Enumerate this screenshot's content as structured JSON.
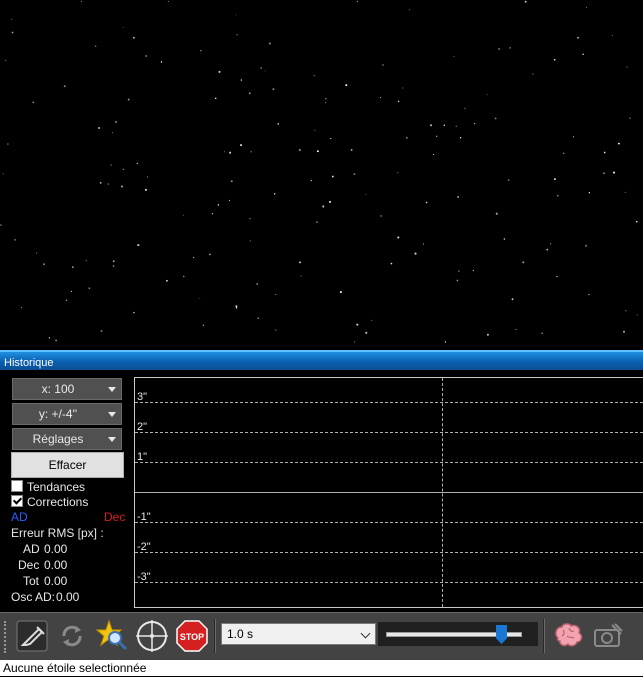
{
  "panel": {
    "title": "Historique"
  },
  "controls": {
    "x_scale": "x: 100",
    "y_scale": "y: +/-4''",
    "settings": "Réglages",
    "clear": "Effacer",
    "trends": {
      "label": "Tendances",
      "checked": false
    },
    "corrections": {
      "label": "Corrections",
      "checked": true
    },
    "legend_ra": "AD",
    "legend_dec": "Dec"
  },
  "stats": {
    "rms_title": "Erreur RMS [px] :",
    "ad_label": "AD",
    "ad_value": "0.00",
    "dec_label": "Dec",
    "dec_value": "0.00",
    "tot_label": "Tot",
    "tot_value": "0.00",
    "osc_label": "Osc AD:",
    "osc_value": "0.00"
  },
  "graph": {
    "y_labels": [
      "3\"",
      "2\"",
      "1\"",
      "-1\"",
      "-2\"",
      "-3\""
    ],
    "colors": {
      "ra": "#2a5cff",
      "dec": "#e01a1a"
    }
  },
  "toolbar": {
    "icons": [
      "guide-icon",
      "loop-icon",
      "auto-select-star-icon",
      "crosshair-icon",
      "stop-icon",
      "brain-icon",
      "camera-settings-icon"
    ],
    "stop_label": "STOP",
    "exposure": "1.0 s",
    "gamma_level": 0.88
  },
  "status": {
    "text": "Aucune étoile selectionnée"
  }
}
